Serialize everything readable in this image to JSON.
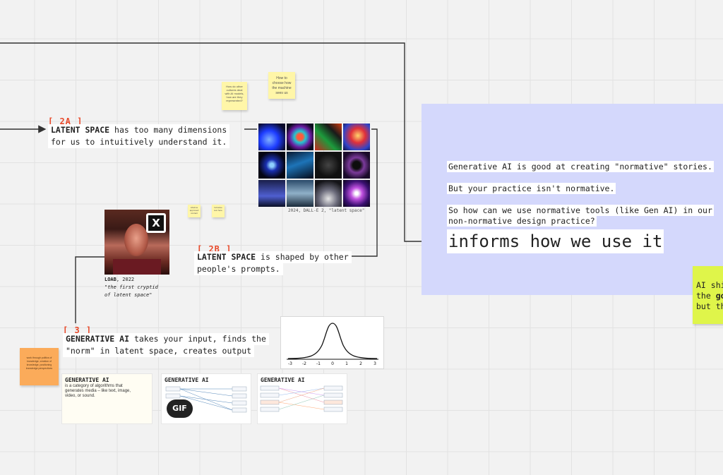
{
  "section_2a": {
    "tag": "[ 2A ]",
    "bold": "LATENT SPACE",
    "rest": " has too many dimensions",
    "line2": "for us to intuitively understand it."
  },
  "section_2b": {
    "tag": "[ 2B ]",
    "bold": "LATENT SPACE",
    "rest": " is shaped by other",
    "line2": "people's prompts."
  },
  "section_3": {
    "tag": "[ 3 ]",
    "bold": "GENERATIVE AI",
    "rest": " takes your input, finds the",
    "line2": "\"norm\" in latent space, creates output"
  },
  "stickies": {
    "yellow_1": "How do other cultures deal with AI models, how are they represented?",
    "yellow_2": "How to choose how the machine sees us",
    "yellow_3": "Lifetime approved contact",
    "yellow_4": "Inclusive text here",
    "orange": "work through politics of knowledge, creation of knowledge, positioning knowledge perspectives"
  },
  "image_grid_caption": "2024, DALL-E 2, \"latent space\"",
  "loab": {
    "title": "LOAB",
    "year": ", 2022",
    "caption_line1": "\"the first cryptid",
    "caption_line2": "of latent space\"",
    "x_logo": "X"
  },
  "bell_curve": {
    "ticks": [
      "-3",
      "-2",
      "-1",
      "0",
      "1",
      "2",
      "3"
    ]
  },
  "cards": {
    "card1": {
      "title": "GENERATIVE AI",
      "body": "is a category of algorithms that generates media – like text, image, video, or sound."
    },
    "card2": {
      "title": "GENERATIVE AI",
      "gif_badge": "GIF"
    },
    "card3": {
      "title": "GENERATIVE AI"
    }
  },
  "purple_panel": {
    "line1": "Generative AI is good at creating \"normative\" stories.",
    "line2": "But your practice isn't normative.",
    "line3": "So how can we use normative tools (like Gen AI) in our",
    "line4": "non-normative design practice?",
    "big": "informs how we use it"
  },
  "green_note": {
    "line1": "AI shi",
    "line2_prefix": "the ",
    "line2_bold": "go",
    "line3": "but th"
  },
  "colors": {
    "accent": "#e8492a",
    "purple": "#d4d8fc",
    "green": "#dff54a",
    "yellow": "#fff6a8",
    "orange": "#fbab5a"
  }
}
